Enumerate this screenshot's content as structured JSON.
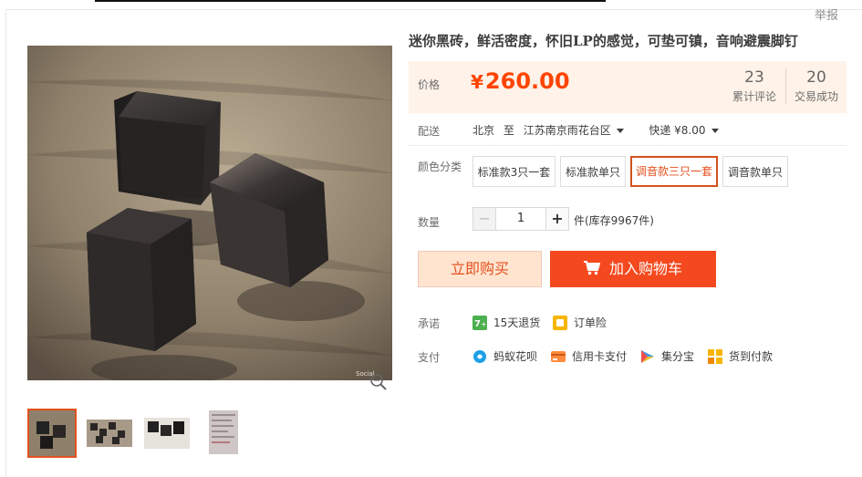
{
  "report_link": "举报",
  "product": {
    "title": "迷你黑砖，鲜活密度，怀旧LP的感觉，可垫可镇，音响避震脚钉",
    "main_image_watermark": "Social"
  },
  "price": {
    "label": "价格",
    "currency": "¥",
    "value": "260.00",
    "reviews_count": "23",
    "reviews_label": "累计评论",
    "deals_count": "20",
    "deals_label": "交易成功"
  },
  "delivery": {
    "label": "配送",
    "from": "北京",
    "to_word": "至",
    "destination": "江苏南京雨花台区",
    "shipping": "快递 ¥8.00"
  },
  "sku": {
    "label": "颜色分类",
    "options": [
      "标准款3只一套",
      "标准款单只",
      "调音款三只一套",
      "调音款单只"
    ],
    "selected_index": 2
  },
  "quantity": {
    "label": "数量",
    "value": "1",
    "minus": "−",
    "plus": "+",
    "stock_text": "件(库存9967件)"
  },
  "buttons": {
    "buy_now": "立即购买",
    "add_to_cart": "加入购物车"
  },
  "promise": {
    "label": "承诺",
    "items": [
      "15天退货",
      "订单险"
    ]
  },
  "payment": {
    "label": "支付",
    "items": [
      "蚂蚁花呗",
      "信用卡支付",
      "集分宝",
      "货到付款"
    ]
  },
  "colors": {
    "accent": "#f40",
    "cart_button": "#f4491e",
    "price_bg": "#fff2e8"
  }
}
